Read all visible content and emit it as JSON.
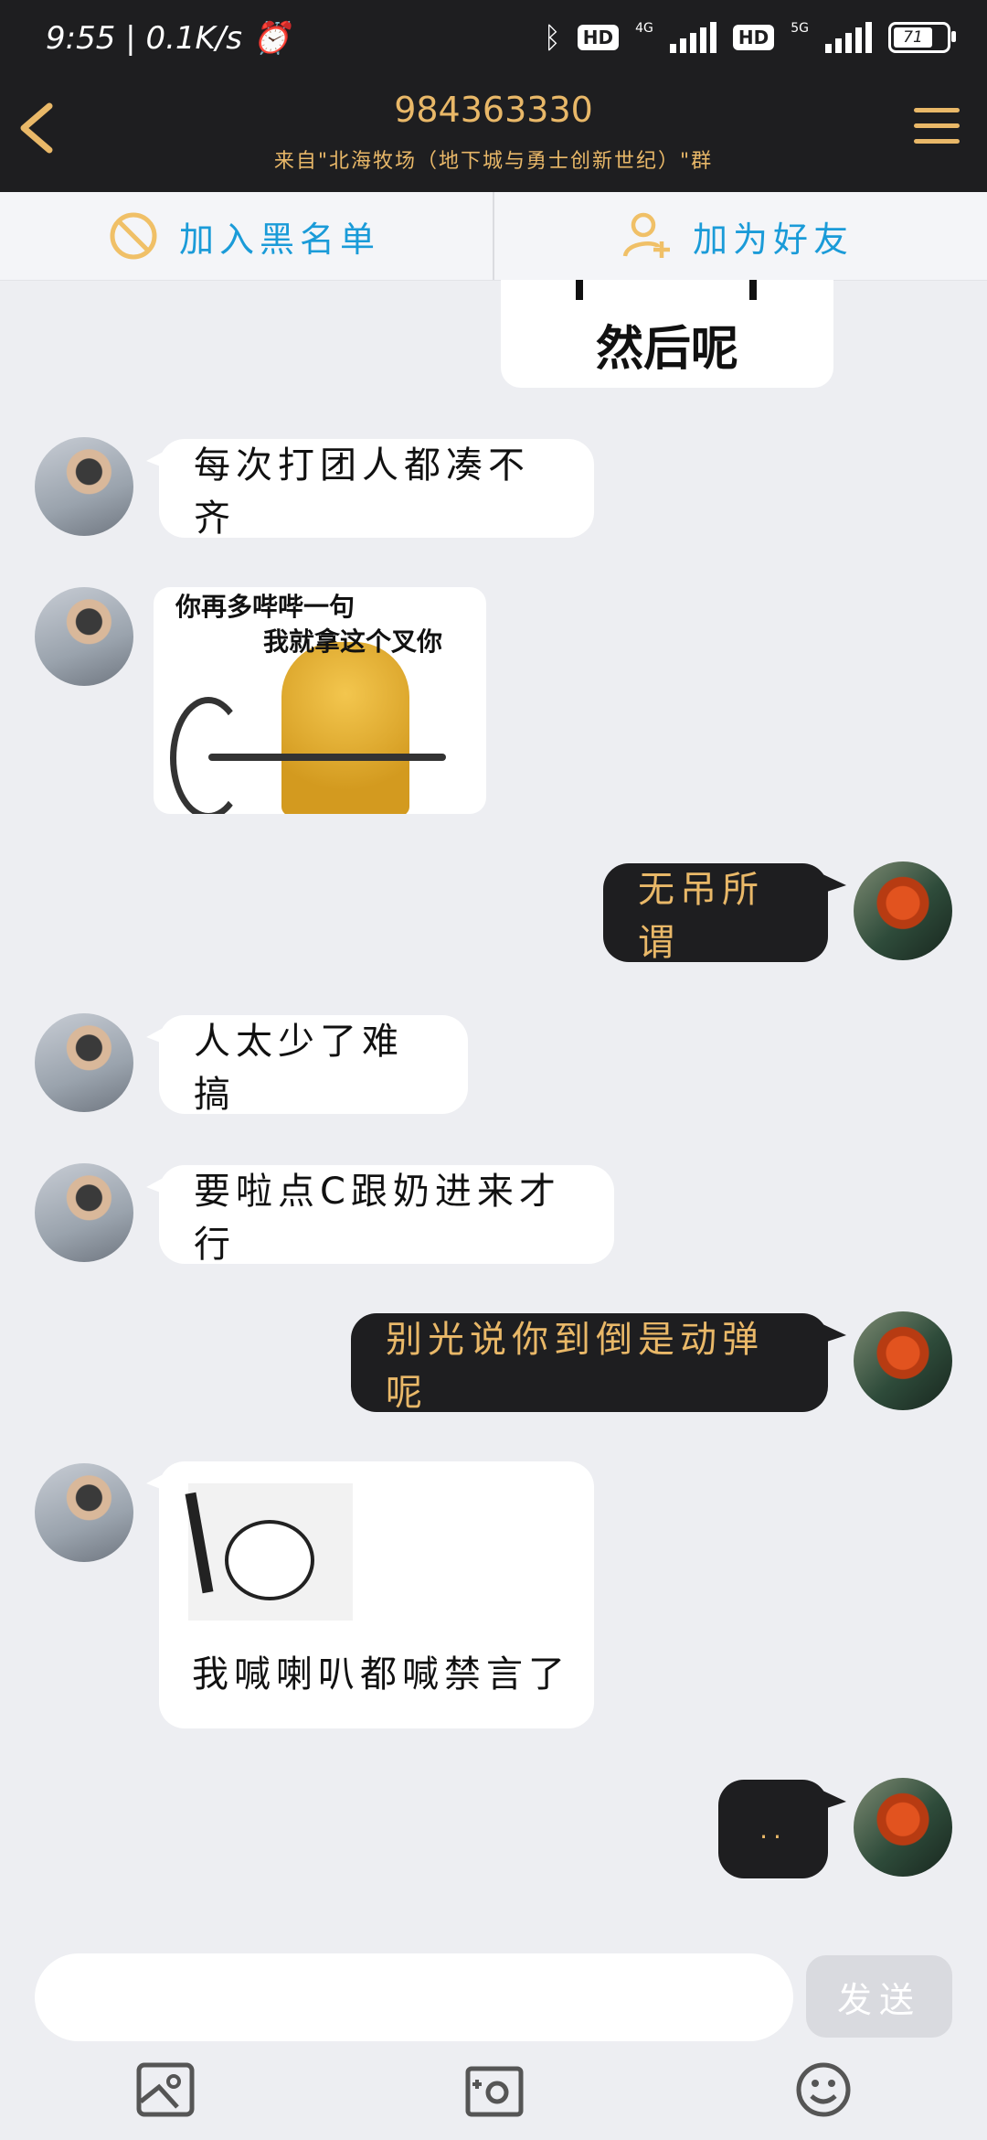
{
  "status_bar": {
    "time": "9:55",
    "network_speed": "0.1K/s",
    "hd1": "HD",
    "net1": "4G",
    "hd2": "HD",
    "net2": "5G",
    "battery": "71"
  },
  "header": {
    "title": "984363330",
    "subtitle": "来自\"北海牧场（地下城与勇士创新世纪）\"群"
  },
  "actions": {
    "blacklist_label": "加入黑名单",
    "add_friend_label": "加为好友"
  },
  "messages": {
    "sticker_top_text": "然后呢",
    "m1": "每次打团人都凑不齐",
    "doge_caption_1": "你再多哔哔一句",
    "doge_caption_2": "我就拿这个叉你",
    "m2": "无吊所谓",
    "m3": "人太少了难搞",
    "m4": "要啦点C跟奶进来才行",
    "m5": "别光说你到倒是动弹呢",
    "m6": "我喊喇叭都喊禁言了",
    "m7": ".."
  },
  "composer": {
    "send_label": "发送"
  },
  "colors": {
    "accent_gold": "#e9b868",
    "dark": "#1e1e20",
    "link_blue": "#1a9bd8",
    "background": "#edeef2"
  },
  "icons": [
    "back-arrow-icon",
    "menu-icon",
    "block-icon",
    "add-friend-icon",
    "image-icon",
    "camera-icon",
    "emoji-icon"
  ]
}
